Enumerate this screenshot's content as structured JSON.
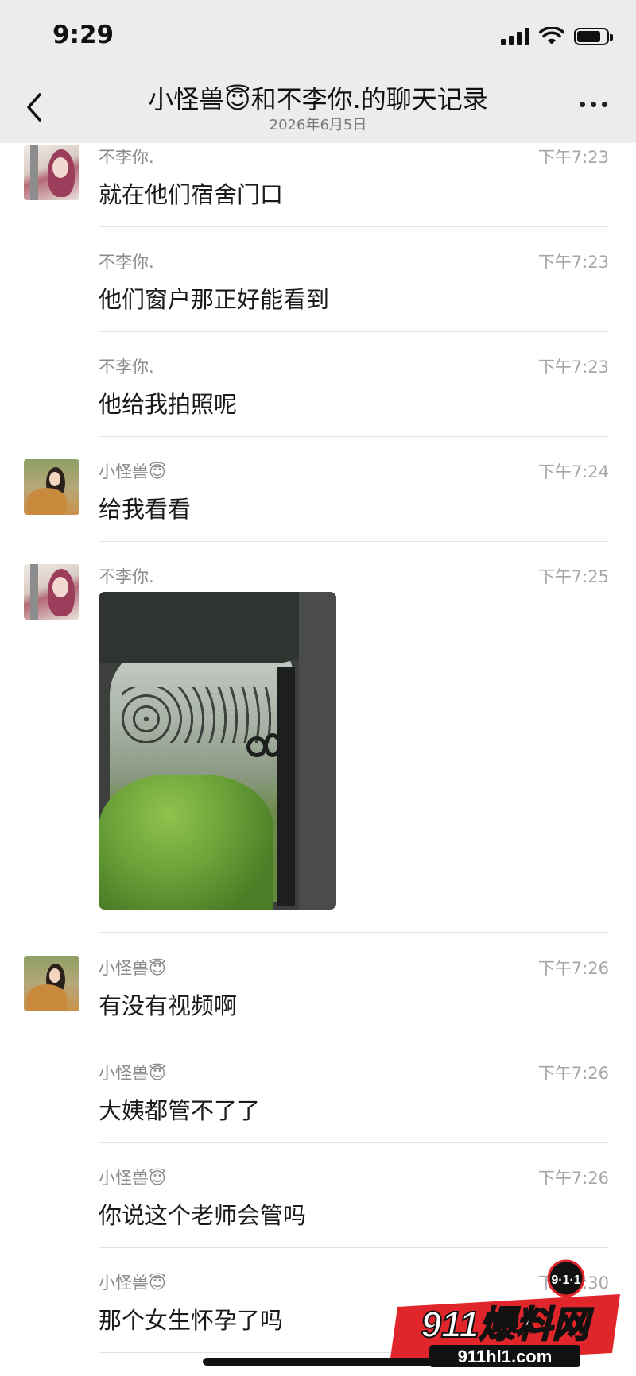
{
  "status_bar": {
    "time": "9:29"
  },
  "header": {
    "title": "小怪兽😇和不李你.的聊天记录",
    "subtitle": "2026年6月5日",
    "back_icon": "chevron-left-icon",
    "more_icon": "ellipsis-icon"
  },
  "messages": [
    {
      "sender": "不李你.",
      "time": "下午7:23",
      "text": "就在他们宿舍门口"
    },
    {
      "sender": "不李你.",
      "time": "下午7:23",
      "text": "他们窗户那正好能看到"
    },
    {
      "sender": "不李你.",
      "time": "下午7:23",
      "text": "他给我拍照呢"
    },
    {
      "sender": "小怪兽😇",
      "time": "下午7:24",
      "text": "给我看看"
    },
    {
      "sender": "不李你.",
      "time": "下午7:25",
      "text": ""
    },
    {
      "sender": "小怪兽😇",
      "time": "下午7:26",
      "text": "有没有视频啊"
    },
    {
      "sender": "小怪兽😇",
      "time": "下午7:26",
      "text": "大姨都管不了了"
    },
    {
      "sender": "小怪兽😇",
      "time": "下午7:26",
      "text": "你说这个老师会管吗"
    },
    {
      "sender": "小怪兽😇",
      "time": "下午7:30",
      "text": "那个女生怀孕了吗"
    }
  ],
  "watermark": {
    "badge": "9·1·1",
    "brand": "911爆料网",
    "url": "911hl1.com"
  },
  "colors": {
    "header_bg": "#ececec",
    "watermark_red": "#e0262a"
  }
}
